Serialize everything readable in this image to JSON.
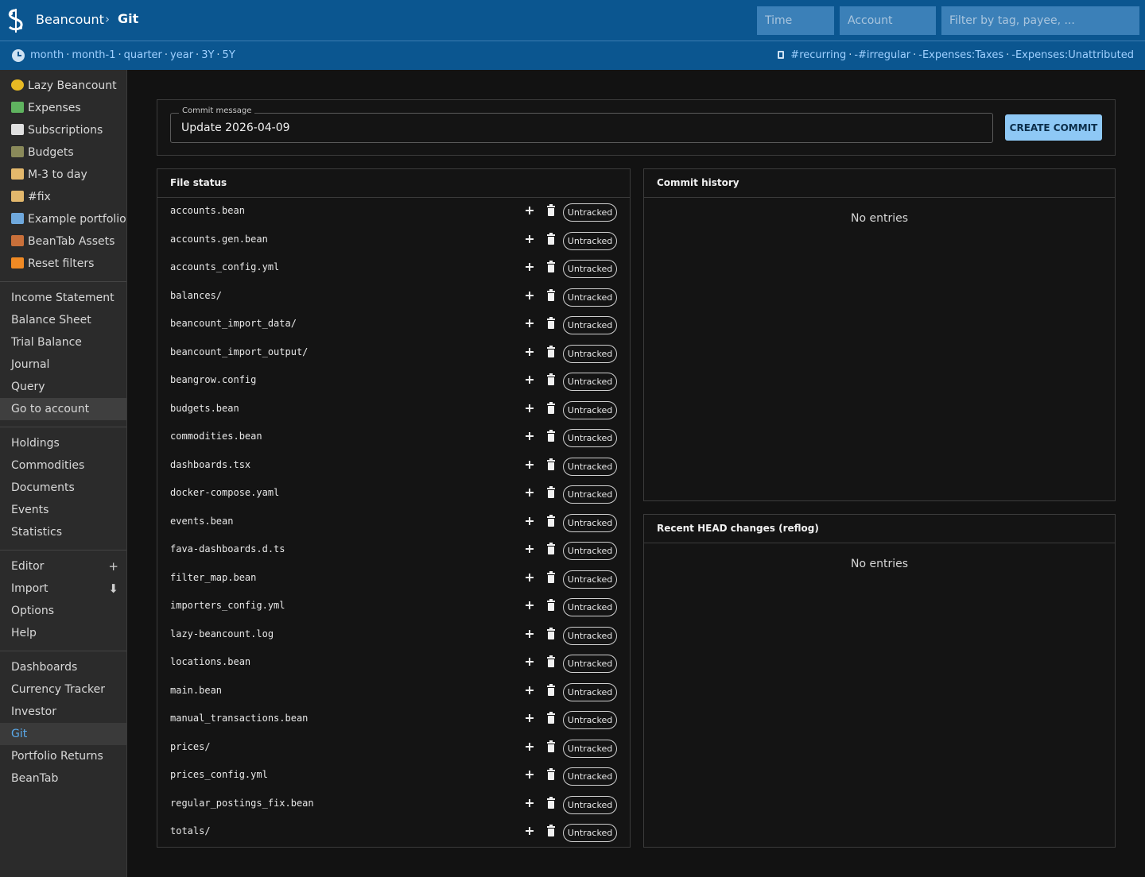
{
  "header": {
    "brand": "Beancount",
    "separator": "›",
    "page": "Git",
    "time_placeholder": "Time",
    "account_placeholder": "Account",
    "filter_placeholder": "Filter by tag, payee, ...",
    "time_links": [
      "month",
      "month-1",
      "quarter",
      "year",
      "3Y",
      "5Y"
    ],
    "filter_links": [
      "#recurring",
      "-#irregular",
      "-Expenses:Taxes",
      "-Expenses:Unattributed"
    ],
    "accent": "#0b5690",
    "link_color": "#9fd0ff"
  },
  "sidebar": {
    "group1": [
      {
        "label": "Lazy Beancount",
        "icon": "coin-icon",
        "color": "#e8b923"
      },
      {
        "label": "Expenses",
        "icon": "money-wings-icon",
        "color": "#5fb35f"
      },
      {
        "label": "Subscriptions",
        "icon": "calendar-icon",
        "color": "#e0e0e0"
      },
      {
        "label": "Budgets",
        "icon": "traffic-light-icon",
        "color": "#8a8a5a"
      },
      {
        "label": "M-3 to day",
        "icon": "scroll-icon",
        "color": "#e3b86c"
      },
      {
        "label": "#fix",
        "icon": "scroll-icon",
        "color": "#e3b86c"
      },
      {
        "label": "Example portfolio",
        "icon": "chart-icon",
        "color": "#6fa8dc"
      },
      {
        "label": "BeanTab Assets",
        "icon": "abacus-icon",
        "color": "#c9703a"
      },
      {
        "label": "Reset filters",
        "icon": "repeat-icon",
        "color": "#f08a24"
      }
    ],
    "group2": [
      "Income Statement",
      "Balance Sheet",
      "Trial Balance",
      "Journal",
      "Query",
      "Go to account"
    ],
    "group3": [
      "Holdings",
      "Commodities",
      "Documents",
      "Events",
      "Statistics"
    ],
    "group4": [
      {
        "label": "Editor",
        "action": "+"
      },
      {
        "label": "Import",
        "action": "⬇"
      },
      {
        "label": "Options",
        "action": ""
      },
      {
        "label": "Help",
        "action": ""
      }
    ],
    "group5": [
      "Dashboards",
      "Currency Tracker",
      "Investor",
      "Git",
      "Portfolio Returns",
      "BeanTab"
    ]
  },
  "commit": {
    "legend": "Commit message",
    "message": "Update 2026-04-09",
    "button": "CREATE COMMIT"
  },
  "file_status": {
    "title": "File status",
    "badge": "Untracked",
    "files": [
      "accounts.bean",
      "accounts.gen.bean",
      "accounts_config.yml",
      "balances/",
      "beancount_import_data/",
      "beancount_import_output/",
      "beangrow.config",
      "budgets.bean",
      "commodities.bean",
      "dashboards.tsx",
      "docker-compose.yaml",
      "events.bean",
      "fava-dashboards.d.ts",
      "filter_map.bean",
      "importers_config.yml",
      "lazy-beancount.log",
      "locations.bean",
      "main.bean",
      "manual_transactions.bean",
      "prices/",
      "prices_config.yml",
      "regular_postings_fix.bean",
      "totals/"
    ]
  },
  "commit_history": {
    "title": "Commit history",
    "empty": "No entries"
  },
  "reflog": {
    "title": "Recent HEAD changes (reflog)",
    "empty": "No entries"
  }
}
